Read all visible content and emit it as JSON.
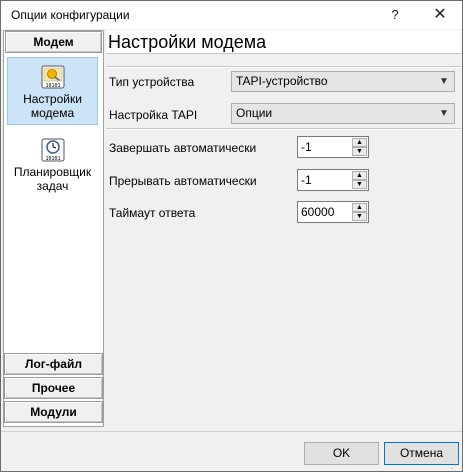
{
  "window": {
    "title": "Опции конфигурации",
    "help_glyph": "?",
    "close_glyph": "✕"
  },
  "nav": {
    "active_header": "Модем",
    "items": [
      {
        "label": "Настройки модема",
        "icon": "modem-settings-icon",
        "selected": true
      },
      {
        "label": "Планировщик задач",
        "icon": "scheduler-clock-icon",
        "selected": false
      }
    ],
    "bottom_headers": [
      "Лог-файл",
      "Прочее",
      "Модули"
    ]
  },
  "main": {
    "title": "Настройки модема",
    "device_type": {
      "label": "Тип устройства",
      "value": "TAPI-устройство"
    },
    "tapi_setup": {
      "label": "Настройка TAPI",
      "value": "Опции"
    },
    "auto_finish": {
      "label": "Завершать автоматически",
      "value": "-1"
    },
    "auto_interrupt": {
      "label": "Прерывать автоматически",
      "value": "-1"
    },
    "timeout": {
      "label": "Таймаут ответа",
      "value": "60000"
    }
  },
  "footer": {
    "ok_label": "OK",
    "cancel_label": "Отмена"
  },
  "colors": {
    "selected_bg": "#cce4f7",
    "selected_border": "#99c9ef",
    "focus_border": "#0078d7"
  }
}
